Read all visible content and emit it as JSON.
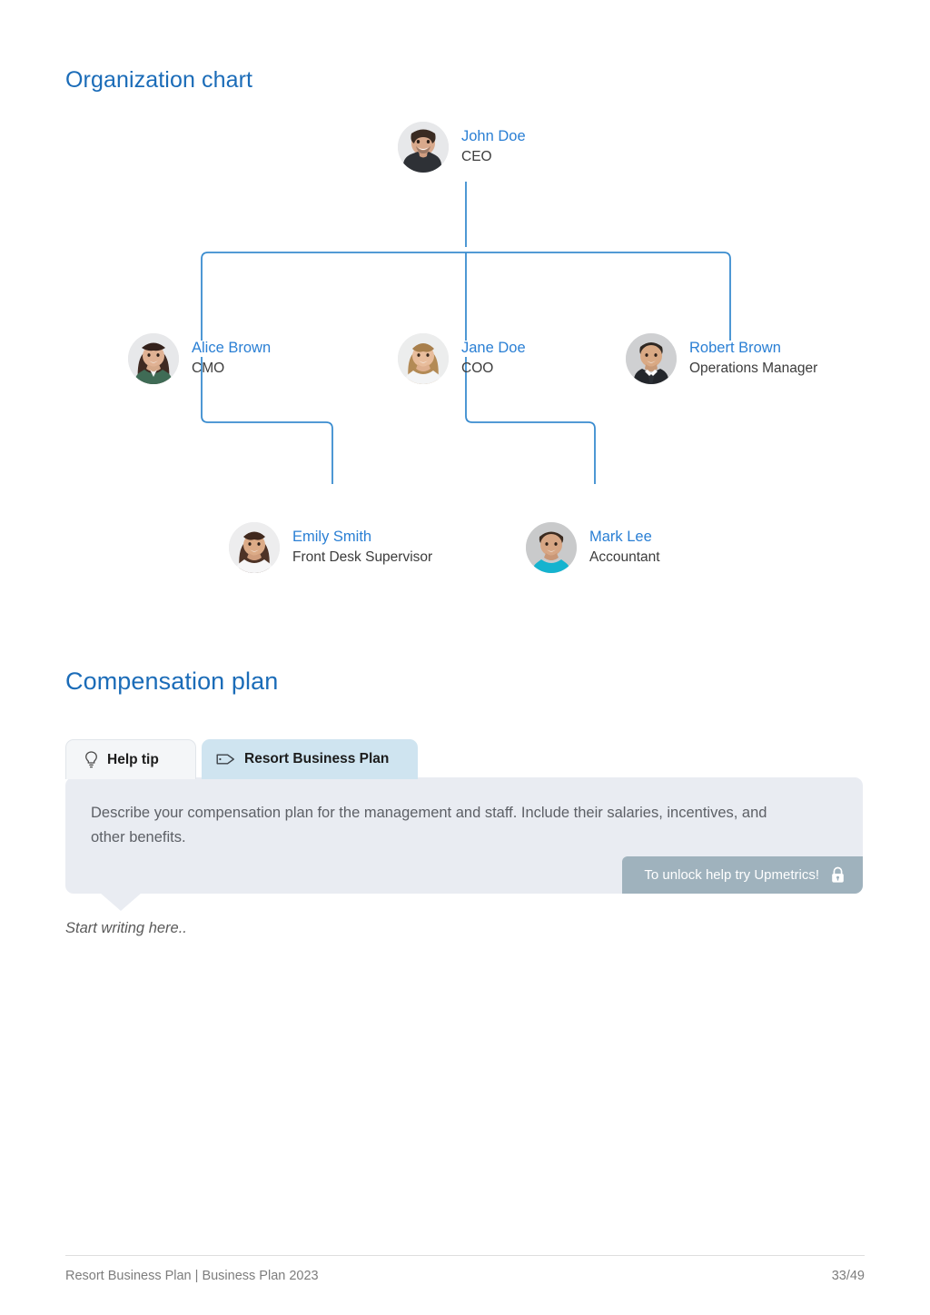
{
  "sections": {
    "org_chart_title": "Organization chart",
    "compensation_title": "Compensation plan"
  },
  "org_chart": {
    "nodes": [
      {
        "id": "ceo",
        "name": "John Doe",
        "role": "CEO",
        "level": 0,
        "avatar": "man-dark-shirt"
      },
      {
        "id": "cmo",
        "name": "Alice Brown",
        "role": "CMO",
        "level": 1,
        "avatar": "woman-dark-hair"
      },
      {
        "id": "coo",
        "name": "Jane Doe",
        "role": "COO",
        "level": 1,
        "avatar": "woman-blonde"
      },
      {
        "id": "ops",
        "name": "Robert Brown",
        "role": "Operations Manager",
        "level": 1,
        "avatar": "man-suit-tie"
      },
      {
        "id": "frontdesk",
        "name": "Emily Smith",
        "role": "Front Desk Supervisor",
        "level": 2,
        "avatar": "woman-white-shirt"
      },
      {
        "id": "acct",
        "name": "Mark Lee",
        "role": "Accountant",
        "level": 2,
        "avatar": "man-teal-shirt"
      }
    ],
    "edges": [
      {
        "from": "ceo",
        "to": "cmo"
      },
      {
        "from": "ceo",
        "to": "coo"
      },
      {
        "from": "ceo",
        "to": "ops"
      },
      {
        "from": "cmo",
        "to": "frontdesk"
      },
      {
        "from": "coo",
        "to": "acct"
      }
    ],
    "connector_color": "#3a8ccf"
  },
  "help_tip": {
    "tabs": [
      {
        "label": "Help tip",
        "icon": "lightbulb-icon",
        "active": false
      },
      {
        "label": "Resort Business Plan",
        "icon": "tag-icon",
        "active": true
      }
    ],
    "body": "Describe your compensation plan for the management and staff. Include their salaries, incentives, and other benefits.",
    "unlock_label": "To unlock help try Upmetrics!",
    "unlock_icon": "lock-icon",
    "background": "#e9ecf2",
    "badge_color": "#9fb2bd"
  },
  "editor": {
    "placeholder": "Start writing here.."
  },
  "footer": {
    "left": "Resort Business Plan | Business Plan 2023",
    "page": "33/49"
  }
}
